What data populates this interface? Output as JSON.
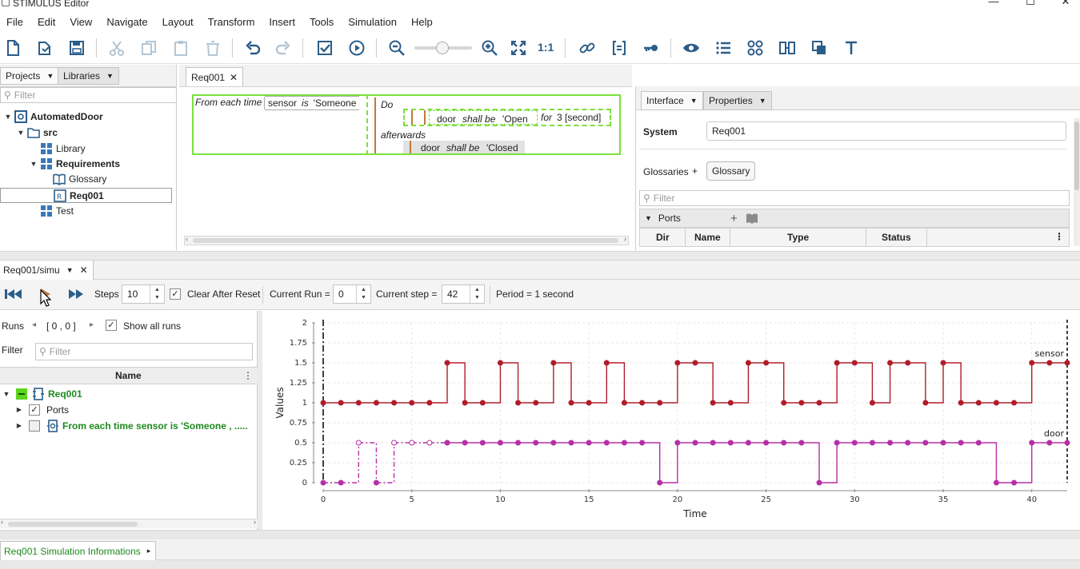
{
  "window": {
    "title": "STIMULUS Editor"
  },
  "menu": [
    "File",
    "Edit",
    "View",
    "Navigate",
    "Layout",
    "Transform",
    "Insert",
    "Tools",
    "Simulation",
    "Help"
  ],
  "toolbar": {
    "zoom_reset_label": "1:1",
    "zoom_fraction": 0.48
  },
  "projects": {
    "tabs": [
      "Projects",
      "Libraries"
    ],
    "filter_placeholder": "Filter",
    "tree": {
      "root": "AutomatedDoor",
      "src": "src",
      "library": "Library",
      "requirements": "Requirements",
      "glossary": "Glossary",
      "req001": "Req001",
      "test": "Test"
    }
  },
  "editor": {
    "tab_label": "Req001",
    "req": {
      "from_each_time": "From each time",
      "cond_subject": "sensor",
      "cond_verb": "is",
      "cond_value": "'Someone",
      "do_label": "Do",
      "action_subject": "door",
      "action_verb": "shall be",
      "action_value": "'Open",
      "for_label": "for",
      "for_value": "3 [second]",
      "afterwards_label": "afterwards",
      "after_subject": "door",
      "after_verb": "shall be",
      "after_value": "'Closed"
    }
  },
  "interface": {
    "tabs": [
      "Interface",
      "Properties"
    ],
    "system_label": "System",
    "system_value": "Req001",
    "glossaries_label": "Glossaries",
    "glossaries_plus": "+",
    "glossary_button": "Glossary",
    "filter_placeholder": "Filter",
    "ports_label": "Ports",
    "columns": [
      "Dir",
      "Name",
      "Type",
      "Status"
    ]
  },
  "simulation": {
    "tab_label": "Req001/simu",
    "steps_label": "Steps",
    "steps_value": "10",
    "clear_after_reset_label": "Clear After Reset",
    "current_run_label": "Current Run =",
    "current_run_value": "0",
    "current_step_label": "Current step =",
    "current_step_value": "42",
    "period_label": "Period = 1 second",
    "runs_label": "Runs",
    "runs_range": "[ 0 , 0 ]",
    "show_all_runs_label": "Show all runs",
    "filter_label": "Filter",
    "filter_placeholder": "Filter",
    "name_column": "Name",
    "tree": {
      "req001": "Req001",
      "ports": "Ports",
      "requirement": "From each time  sensor is  'Someone , ....."
    }
  },
  "bottom": {
    "tab_label": "Req001 Simulation Informations"
  },
  "chart_data": {
    "type": "line",
    "step": true,
    "xlabel": "Time",
    "ylabel": "Values",
    "xlim": [
      0,
      42
    ],
    "ylim": [
      0,
      2
    ],
    "x_ticks": [
      0,
      5,
      10,
      15,
      20,
      25,
      30,
      35,
      40
    ],
    "y_ticks": [
      "0",
      "0.25",
      "0.5",
      "0.75",
      "1",
      "1.25",
      "1.5",
      "1.75",
      "2"
    ],
    "grid": true,
    "current_step_marker": 42,
    "series": [
      {
        "name": "sensor",
        "color": "#b01d2a",
        "x": [
          0,
          1,
          2,
          3,
          4,
          5,
          6,
          7,
          8,
          9,
          10,
          11,
          12,
          13,
          14,
          15,
          16,
          17,
          18,
          19,
          20,
          21,
          22,
          23,
          24,
          25,
          26,
          27,
          28,
          29,
          30,
          31,
          32,
          33,
          34,
          35,
          36,
          37,
          38,
          39,
          40,
          41,
          42
        ],
        "values": [
          1,
          1,
          1,
          1,
          1,
          1,
          1,
          1.5,
          1,
          1,
          1.5,
          1,
          1,
          1.5,
          1,
          1,
          1.5,
          1,
          1,
          1,
          1.5,
          1.5,
          1,
          1,
          1.5,
          1.5,
          1,
          1,
          1,
          1.5,
          1.5,
          1,
          1.5,
          1.5,
          1,
          1.5,
          1,
          1,
          1,
          1,
          1.5,
          1.5,
          1.5
        ]
      },
      {
        "name": "door",
        "color": "#b52fa6",
        "x": [
          0,
          1,
          2,
          3,
          4,
          5,
          6,
          7,
          8,
          9,
          10,
          11,
          12,
          13,
          14,
          15,
          16,
          17,
          18,
          19,
          20,
          21,
          22,
          23,
          24,
          25,
          26,
          27,
          28,
          29,
          30,
          31,
          32,
          33,
          34,
          35,
          36,
          37,
          38,
          39,
          40,
          41,
          42
        ],
        "values": [
          0,
          0,
          0.5,
          0,
          0.5,
          0.5,
          0.5,
          0.5,
          0.5,
          0.5,
          0.5,
          0.5,
          0.5,
          0.5,
          0.5,
          0.5,
          0.5,
          0.5,
          0.5,
          0,
          0.5,
          0.5,
          0.5,
          0.5,
          0.5,
          0.5,
          0.5,
          0.5,
          0,
          0.5,
          0.5,
          0.5,
          0.5,
          0.5,
          0.5,
          0.5,
          0.5,
          0.5,
          0,
          0,
          0.5,
          0.5,
          0.5
        ],
        "dashed_until": 7
      }
    ]
  },
  "colors": {
    "accent_green": "#7ce03a",
    "tree_green": "#1d8a1d",
    "icon_blue": "#2b5d8a"
  }
}
